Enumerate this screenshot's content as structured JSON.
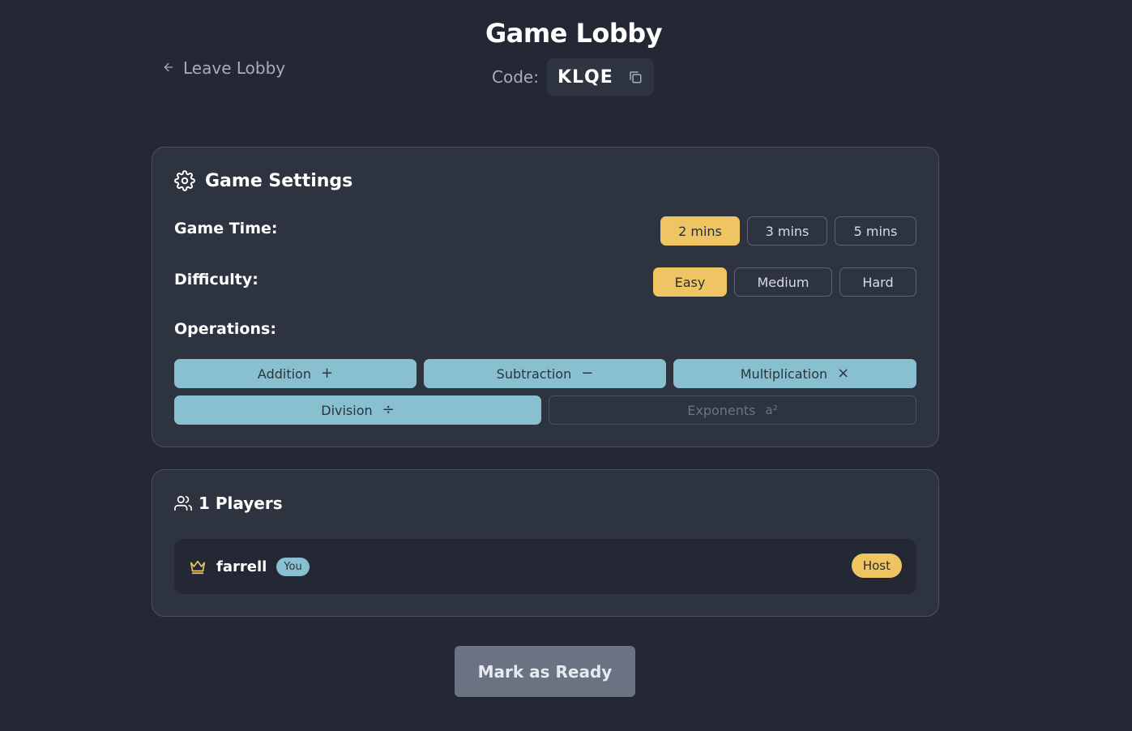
{
  "header": {
    "title": "Game Lobby",
    "leave_label": "Leave Lobby",
    "code_label": "Code:",
    "code_value": "KLQE"
  },
  "settings": {
    "title": "Game Settings",
    "game_time": {
      "label": "Game Time:",
      "options": [
        "2 mins",
        "3 mins",
        "5 mins"
      ],
      "selected": "2 mins"
    },
    "difficulty": {
      "label": "Difficulty:",
      "options": [
        "Easy",
        "Medium",
        "Hard"
      ],
      "selected": "Easy"
    },
    "operations": {
      "label": "Operations:",
      "items": [
        {
          "label": "Addition",
          "symbol": "+",
          "enabled": true
        },
        {
          "label": "Subtraction",
          "symbol": "−",
          "enabled": true
        },
        {
          "label": "Multiplication",
          "symbol": "×",
          "enabled": true
        },
        {
          "label": "Division",
          "symbol": "÷",
          "enabled": true
        },
        {
          "label": "Exponents",
          "symbol": "a²",
          "enabled": false
        }
      ]
    }
  },
  "players": {
    "title": "1 Players",
    "list": [
      {
        "name": "farrell",
        "you_badge": "You",
        "role_badge": "Host"
      }
    ]
  },
  "footer": {
    "ready_label": "Mark as Ready"
  },
  "colors": {
    "background": "#232834",
    "card": "#2e3340",
    "accent_yellow": "#efc564",
    "accent_blue": "#88c0d0",
    "ready_button": "#6b7282"
  }
}
